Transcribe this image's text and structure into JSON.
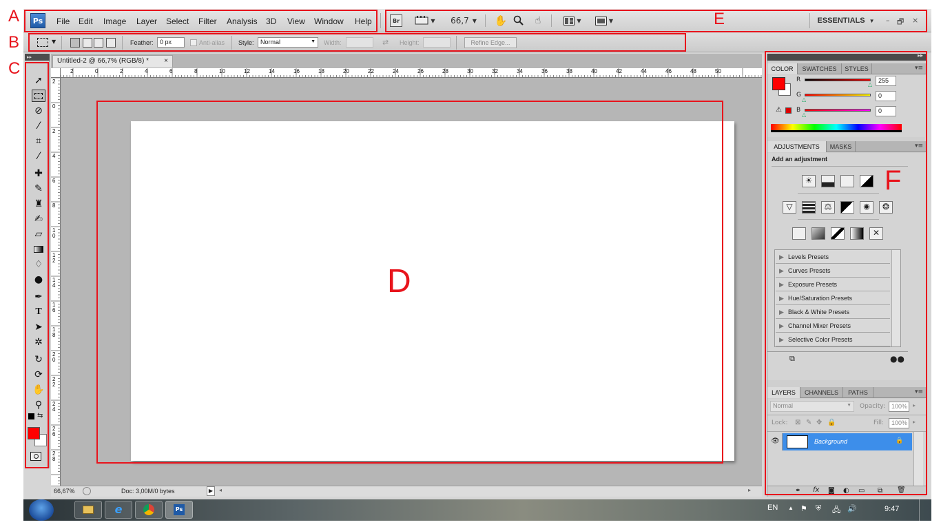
{
  "annotations": {
    "letters": [
      "A",
      "B",
      "C",
      "D",
      "E",
      "F"
    ]
  },
  "menubar": {
    "logo": "Ps",
    "items": [
      "File",
      "Edit",
      "Image",
      "Layer",
      "Select",
      "Filter",
      "Analysis",
      "3D",
      "View",
      "Window",
      "Help"
    ],
    "bridge_label": "Br",
    "zoom_value": "66,7",
    "workspace": "ESSENTIALS",
    "window_controls": [
      "–",
      "🗗",
      "×"
    ]
  },
  "options_bar": {
    "feather_label": "Feather:",
    "feather_value": "0 px",
    "anti_alias_label": "Anti-alias",
    "style_label": "Style:",
    "style_value": "Normal",
    "width_label": "Width:",
    "height_label": "Height:",
    "refine_edge_label": "Refine Edge..."
  },
  "document": {
    "tab_title": "Untitled-2 @ 66,7% (RGB/8) *",
    "tab_close": "×",
    "zoom_status": "66,67%",
    "doc_status": "Doc: 3,00M/0 bytes",
    "ruler_top_labels": [
      "2",
      "0",
      "2",
      "4",
      "6",
      "8",
      "10",
      "12",
      "14",
      "16",
      "18",
      "20",
      "22",
      "24",
      "26",
      "28",
      "30",
      "32",
      "34",
      "36",
      "38",
      "40",
      "42",
      "44",
      "46",
      "48",
      "50"
    ],
    "ruler_left_labels": [
      "2",
      "0",
      "2",
      "4",
      "6",
      "8",
      "10",
      "12",
      "14",
      "16",
      "18",
      "20",
      "22",
      "24",
      "26",
      "28"
    ]
  },
  "color_panel": {
    "tabs": [
      "COLOR",
      "SWATCHES",
      "STYLES"
    ],
    "channels": [
      {
        "label": "R",
        "value": "255"
      },
      {
        "label": "G",
        "value": "0"
      },
      {
        "label": "B",
        "value": "0"
      }
    ],
    "foreground_color": "#ff0000",
    "background_color": "#ffffff"
  },
  "adjustments_panel": {
    "tabs": [
      "ADJUSTMENTS",
      "MASKS"
    ],
    "heading": "Add an adjustment",
    "presets": [
      "Levels Presets",
      "Curves Presets",
      "Exposure Presets",
      "Hue/Saturation Presets",
      "Black & White Presets",
      "Channel Mixer Presets",
      "Selective Color Presets"
    ]
  },
  "layers_panel": {
    "tabs": [
      "LAYERS",
      "CHANNELS",
      "PATHS"
    ],
    "blend_mode": "Normal",
    "opacity_label": "Opacity:",
    "opacity_value": "100%",
    "lock_label": "Lock:",
    "fill_label": "Fill:",
    "fill_value": "100%",
    "layers": [
      {
        "name": "Background"
      }
    ]
  },
  "taskbar": {
    "language": "EN",
    "clock": "9:47"
  }
}
